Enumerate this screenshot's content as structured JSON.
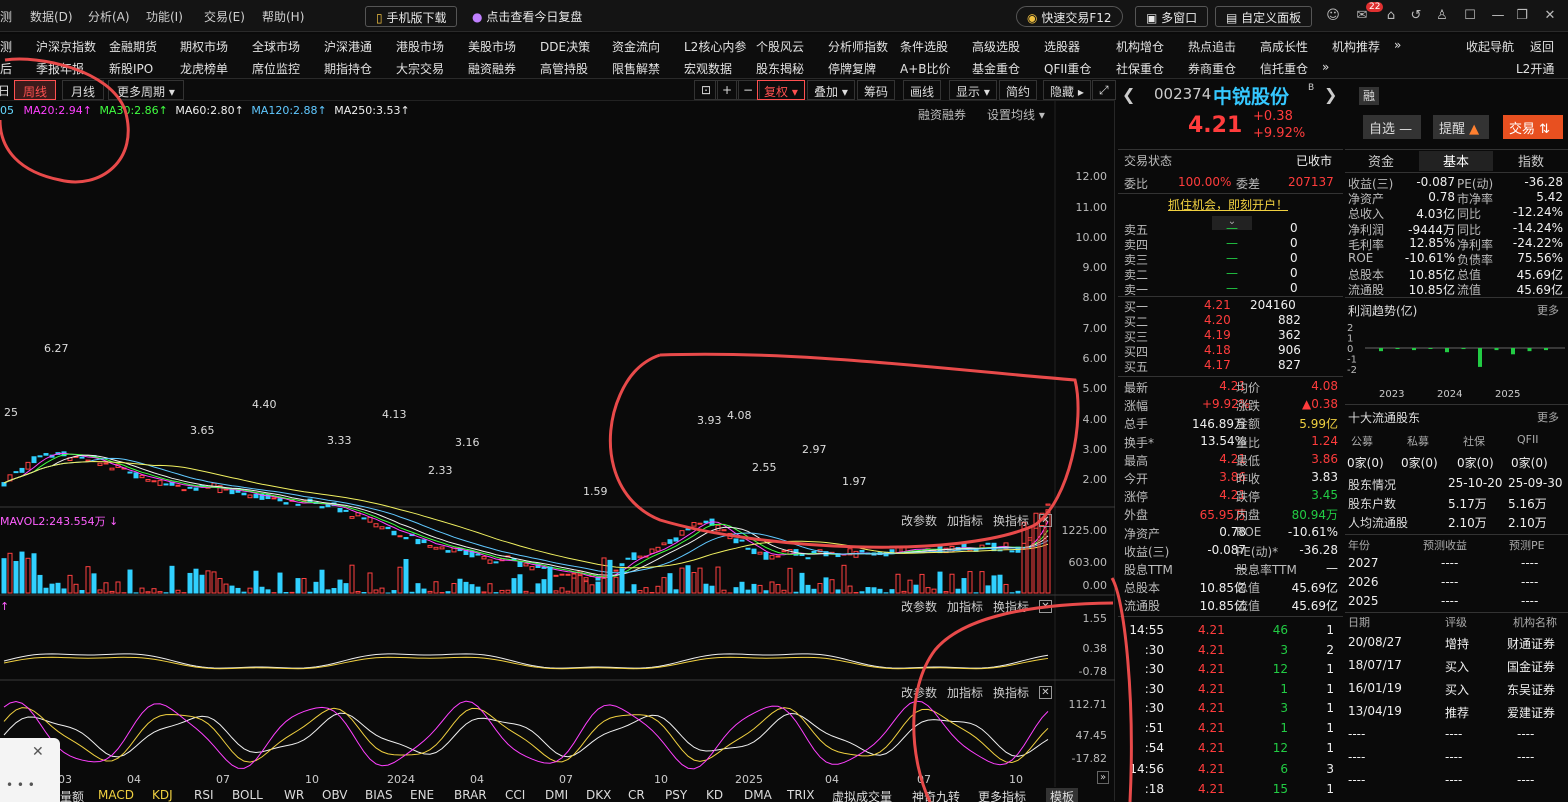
{
  "topbar": {
    "menus": [
      "测",
      "数据(D)",
      "分析(A)",
      "功能(I)",
      "交易(E)",
      "帮助(H)"
    ],
    "mobile_download": "手机版下载",
    "review": "点击查看今日复盘",
    "quick_trade": "快速交易F12",
    "multi_window": "多窗口",
    "custom_panel": "自定义面板",
    "mail_badge": "22"
  },
  "nav1": [
    "测",
    "沪深京指数",
    "金融期货",
    "期权市场",
    "全球市场",
    "沪深港通",
    "港股市场",
    "美股市场",
    "DDE决策",
    "资金流向",
    "L2核心内参",
    "个股风云",
    "分析师指数",
    "条件选股",
    "高级选股",
    "选股器",
    "机构增仓",
    "热点追击",
    "高成长性",
    "机构推荐",
    "收起导航",
    "返回"
  ],
  "nav2": [
    "后",
    "季报年报",
    "新股IPO",
    "龙虎榜单",
    "席位监控",
    "期指持仓",
    "大宗交易",
    "融资融券",
    "高管持股",
    "限售解禁",
    "宏观数据",
    "股东揭秘",
    "停牌复牌",
    "A+B比价",
    "基金重仓",
    "QFII重仓",
    "社保重仓",
    "券商重仓",
    "信托重仓",
    "L2开通"
  ],
  "toolbar": {
    "periods": [
      "日",
      "周线",
      "月线",
      "更多周期"
    ],
    "buttons": [
      "复权",
      "叠加",
      "筹码",
      "画线",
      "显示",
      "简约",
      "隐藏"
    ]
  },
  "ma_line": {
    "items": [
      {
        "label": "05",
        "color": "#f0f0f0"
      },
      {
        "label": "MA20:2.94",
        "color": "#ff40ff"
      },
      {
        "label": "MA30:2.86",
        "color": "#40ff40"
      },
      {
        "label": "MA60:2.80",
        "color": "#f0f0f0"
      },
      {
        "label": "MA120:2.88",
        "color": "#60c8ff"
      },
      {
        "label": "MA250:3.53",
        "color": "#f0f0f0"
      }
    ],
    "margin": "融资融券",
    "set_ma": "设置均线"
  },
  "axis": {
    "price": [
      "12.00",
      "11.00",
      "10.00",
      "9.00",
      "8.00",
      "7.00",
      "6.00",
      "5.00",
      "4.00",
      "3.00",
      "2.00"
    ],
    "vol": [
      "1225.00",
      "603.00",
      "0.00"
    ],
    "macd": [
      "1.55",
      "0.38",
      "-0.78"
    ],
    "kdj": [
      "112.71",
      "47.45",
      "-17.82"
    ],
    "time": [
      "03",
      "04",
      "07",
      "10",
      "2024",
      "04",
      "07",
      "10",
      "2025",
      "04",
      "07",
      "10"
    ]
  },
  "price_annotations": [
    "6.27",
    "4.40",
    "25",
    "3.65",
    "4.13",
    "3.33",
    "3.16",
    "2.33",
    "1.59",
    "3.93",
    "4.08",
    "2.97",
    "2.55",
    "1.97"
  ],
  "volume_label": "MAVOL2:243.554万",
  "subpanel_buttons": [
    "改参数",
    "加指标",
    "换指标"
  ],
  "bottom_tabs": [
    "量额",
    "MACD",
    "KDJ",
    "RSI",
    "BOLL",
    "WR",
    "OBV",
    "BIAS",
    "ENE",
    "BRAR",
    "CCI",
    "DMI",
    "DKX",
    "CR",
    "PSY",
    "KD",
    "DMA",
    "TRIX",
    "虚拟成交量",
    "神奇九转",
    "更多指标",
    "模板"
  ],
  "stock": {
    "code": "002374",
    "name": "中锐股份",
    "price": "4.21",
    "change": "+0.38",
    "change_pct": "+9.92%",
    "margin_tag": "融",
    "watch": "自选",
    "remind": "提醒",
    "trade": "交易"
  },
  "trade_status": {
    "label": "交易状态",
    "value": "已收市"
  },
  "weibi": {
    "label1": "委比",
    "value1": "100.00%",
    "label2": "委差",
    "value2": "207137"
  },
  "open_account": "抓住机会，即刻开户！",
  "sell_book": [
    {
      "label": "卖五",
      "price": "—",
      "vol": "0"
    },
    {
      "label": "卖四",
      "price": "—",
      "vol": "0"
    },
    {
      "label": "卖三",
      "price": "—",
      "vol": "0"
    },
    {
      "label": "卖二",
      "price": "—",
      "vol": "0"
    },
    {
      "label": "卖一",
      "price": "—",
      "vol": "0"
    }
  ],
  "buy_book": [
    {
      "label": "买一",
      "price": "4.21",
      "vol": "204160"
    },
    {
      "label": "买二",
      "price": "4.20",
      "vol": "882"
    },
    {
      "label": "买三",
      "price": "4.19",
      "vol": "362"
    },
    {
      "label": "买四",
      "price": "4.18",
      "vol": "906"
    },
    {
      "label": "买五",
      "price": "4.17",
      "vol": "827"
    }
  ],
  "quote": [
    {
      "l1": "最新",
      "v1": "4.21",
      "c1": "red",
      "l2": "均价",
      "v2": "4.08",
      "c2": "red"
    },
    {
      "l1": "涨幅",
      "v1": "+9.92%",
      "c1": "red",
      "l2": "涨跌",
      "v2": "▲0.38",
      "c2": "red"
    },
    {
      "l1": "总手",
      "v1": "146.89万",
      "c1": "wht",
      "l2": "金额",
      "v2": "5.99亿",
      "c2": "yel"
    },
    {
      "l1": "换手*",
      "v1": "13.54%",
      "c1": "wht",
      "l2": "量比",
      "v2": "1.24",
      "c2": "red"
    },
    {
      "l1": "最高",
      "v1": "4.21",
      "c1": "red",
      "l2": "最低",
      "v2": "3.86",
      "c2": "red"
    },
    {
      "l1": "今开",
      "v1": "3.86",
      "c1": "red",
      "l2": "昨收",
      "v2": "3.83",
      "c2": "wht"
    },
    {
      "l1": "涨停",
      "v1": "4.21",
      "c1": "red",
      "l2": "跌停",
      "v2": "3.45",
      "c2": "grn"
    },
    {
      "l1": "外盘",
      "v1": "65.95万",
      "c1": "red",
      "l2": "内盘",
      "v2": "80.94万",
      "c2": "grn"
    },
    {
      "l1": "净资产",
      "v1": "0.78",
      "c1": "wht",
      "l2": "ROE",
      "v2": "-10.61%",
      "c2": "wht"
    },
    {
      "l1": "收益(三)",
      "v1": "-0.087",
      "c1": "wht",
      "l2": "PE(动)*",
      "v2": "-36.28",
      "c2": "wht"
    },
    {
      "l1": "股息TTM",
      "v1": "—",
      "c1": "wht",
      "l2": "股息率TTM",
      "v2": "—",
      "c2": "wht"
    },
    {
      "l1": "总股本",
      "v1": "10.85亿",
      "c1": "wht",
      "l2": "总值",
      "v2": "45.69亿",
      "c2": "wht"
    },
    {
      "l1": "流通股",
      "v1": "10.85亿",
      "c1": "wht",
      "l2": "流值",
      "v2": "45.69亿",
      "c2": "wht"
    }
  ],
  "ticks": [
    {
      "time": "14:55",
      "price": "4.21",
      "vol": "46",
      "n": "1"
    },
    {
      "time": ":30",
      "price": "4.21",
      "vol": "3",
      "n": "2"
    },
    {
      "time": ":30",
      "price": "4.21",
      "vol": "12",
      "n": "1"
    },
    {
      "time": ":30",
      "price": "4.21",
      "vol": "1",
      "n": "1"
    },
    {
      "time": ":30",
      "price": "4.21",
      "vol": "3",
      "n": "1"
    },
    {
      "time": ":51",
      "price": "4.21",
      "vol": "1",
      "n": "1"
    },
    {
      "time": ":54",
      "price": "4.21",
      "vol": "12",
      "n": "1"
    },
    {
      "time": "14:56",
      "price": "4.21",
      "vol": "6",
      "n": "3"
    },
    {
      "time": ":18",
      "price": "4.21",
      "vol": "15",
      "n": "1"
    }
  ],
  "right_tabs": [
    "资金",
    "基本",
    "指数"
  ],
  "fundamentals": [
    {
      "l1": "收益(三)",
      "v1": "-0.087",
      "l2": "PE(动)",
      "v2": "-36.28"
    },
    {
      "l1": "净资产",
      "v1": "0.78",
      "l2": "市净率",
      "v2": "5.42"
    },
    {
      "l1": "总收入",
      "v1": "4.03亿",
      "l2": "同比",
      "v2": "-12.24%"
    },
    {
      "l1": "净利润",
      "v1": "-9444万",
      "l2": "同比",
      "v2": "-14.24%"
    },
    {
      "l1": "毛利率",
      "v1": "12.85%",
      "l2": "净利率",
      "v2": "-24.22%"
    },
    {
      "l1": "ROE",
      "v1": "-10.61%",
      "l2": "负债率",
      "v2": "75.56%"
    },
    {
      "l1": "总股本",
      "v1": "10.85亿",
      "l2": "总值",
      "v2": "45.69亿"
    },
    {
      "l1": "流通股",
      "v1": "10.85亿",
      "l2": "流值",
      "v2": "45.69亿"
    }
  ],
  "profit_trend": {
    "title": "利润趋势(亿)",
    "more": "更多"
  },
  "chart_data": {
    "type": "bar",
    "title": "利润趋势(亿)",
    "categories": [
      "2023",
      "2024",
      "2025"
    ],
    "y_ticks": [
      "2",
      "1",
      "0",
      "-1",
      "-2"
    ],
    "ylim": [
      -2,
      2
    ],
    "values": [
      -0.3,
      -0.1,
      -0.2,
      -0.05,
      -0.4,
      -0.1,
      -1.8,
      -0.2,
      -0.6,
      -0.3,
      -0.2
    ]
  },
  "top_holders": {
    "title": "十大流通股东",
    "more": "更多",
    "headers": [
      "公募",
      "私募",
      "社保",
      "QFII"
    ],
    "values": [
      "0家(0)",
      "0家(0)",
      "0家(0)",
      "0家(0)"
    ]
  },
  "holders_rows": [
    {
      "l": "股东情况",
      "a": "25-10-20",
      "b": "25-09-30"
    },
    {
      "l": "股东户数",
      "a": "5.17万",
      "b": "5.16万"
    },
    {
      "l": "人均流通股",
      "a": "2.10万",
      "b": "2.10万"
    }
  ],
  "forecast": {
    "headers": [
      "年份",
      "预测收益",
      "预测PE"
    ],
    "rows": [
      {
        "y": "2027",
        "a": "----",
        "b": "----"
      },
      {
        "y": "2026",
        "a": "----",
        "b": "----"
      },
      {
        "y": "2025",
        "a": "----",
        "b": "----"
      }
    ]
  },
  "ratings": {
    "headers": [
      "日期",
      "评级",
      "机构名称"
    ],
    "rows": [
      {
        "d": "20/08/27",
        "r": "增持",
        "o": "财通证券"
      },
      {
        "d": "18/07/17",
        "r": "买入",
        "o": "国金证券"
      },
      {
        "d": "16/01/19",
        "r": "买入",
        "o": "东吴证券"
      },
      {
        "d": "13/04/19",
        "r": "推荐",
        "o": "爱建证券"
      }
    ],
    "empty": "----"
  }
}
